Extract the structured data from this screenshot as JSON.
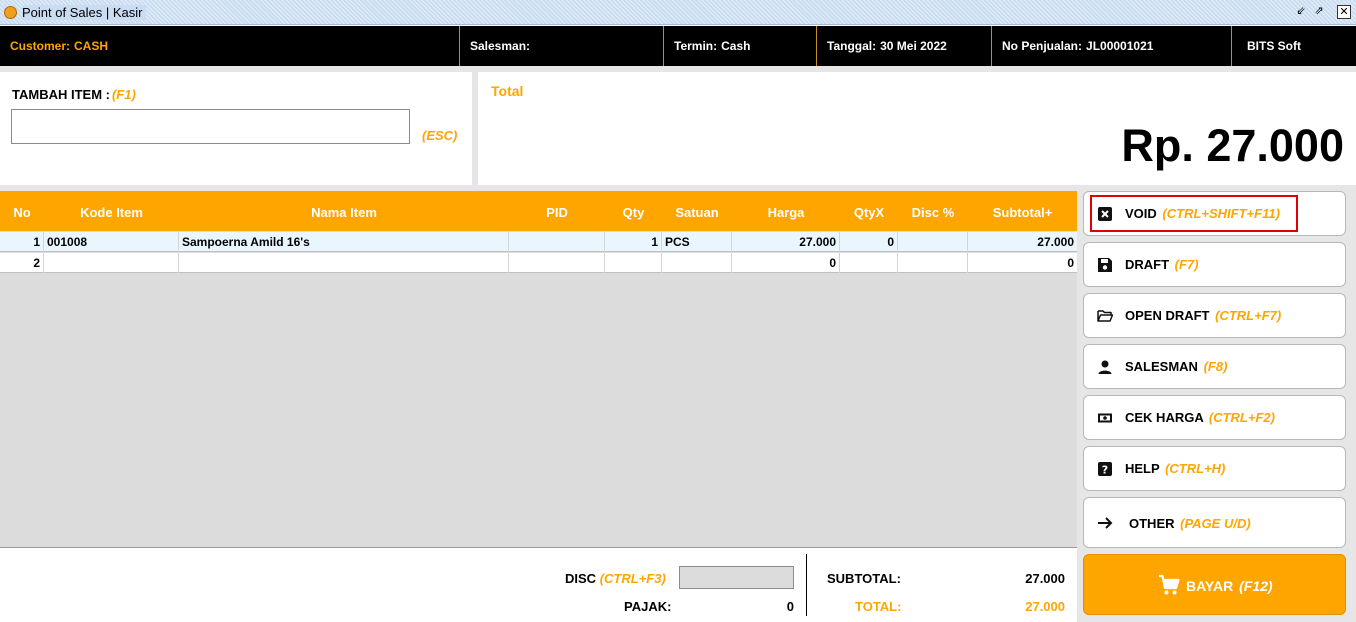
{
  "window": {
    "title": "Point of Sales | Kasir",
    "restore_glyph": "⇙",
    "detach_glyph": "⇗",
    "close_glyph": "✕"
  },
  "infobar": {
    "customer_label": "Customer:",
    "customer_value": "CASH",
    "salesman_label": "Salesman:",
    "salesman_value": "",
    "termin_label": "Termin:",
    "termin_value": "Cash",
    "tanggal_label": "Tanggal:",
    "tanggal_value": "30 Mei 2022",
    "no_label": "No Penjualan:",
    "no_value": "JL00001021",
    "brand": "BITS Soft"
  },
  "add_item": {
    "label": "TAMBAH ITEM :",
    "hotkey": "(F1)",
    "input_value": "",
    "esc_hint": "(ESC)"
  },
  "total": {
    "label": "Total",
    "amount": "Rp. 27.000"
  },
  "grid": {
    "columns": [
      "No",
      "Kode Item",
      "Nama Item",
      "PID",
      "Qty",
      "Satuan",
      "Harga",
      "QtyX",
      "Disc %",
      "Subtotal+"
    ],
    "rows": [
      {
        "no": "1",
        "kode": "001008",
        "nama": "Sampoerna Amild 16's",
        "pid": "",
        "qty": "1",
        "satuan": "PCS",
        "harga": "27.000",
        "qtyx": "0",
        "disc": "",
        "subtotal": "27.000"
      },
      {
        "no": "2",
        "kode": "",
        "nama": "",
        "pid": "",
        "qty": "",
        "satuan": "",
        "harga": "0",
        "qtyx": "",
        "disc": "",
        "subtotal": "0"
      }
    ]
  },
  "actions": {
    "void": {
      "label": "VOID",
      "hotkey": "(CTRL+SHIFT+F11)",
      "icon": "void-icon"
    },
    "draft": {
      "label": "DRAFT",
      "hotkey": "(F7)",
      "icon": "save-icon"
    },
    "open_draft": {
      "label": "OPEN DRAFT",
      "hotkey": "(CTRL+F7)",
      "icon": "folder-open-icon"
    },
    "salesman": {
      "label": "SALESMAN",
      "hotkey": "(F8)",
      "icon": "person-icon"
    },
    "cek_harga": {
      "label": "CEK HARGA",
      "hotkey": "(CTRL+F2)",
      "icon": "money-icon"
    },
    "help": {
      "label": "HELP",
      "hotkey": "(CTRL+H)",
      "icon": "help-icon"
    },
    "other": {
      "label": "OTHER",
      "hotkey": "(PAGE U/D)",
      "icon": "arrow-right-icon"
    },
    "bayar": {
      "label": "BAYAR",
      "hotkey": "(F12)",
      "icon": "cart-icon"
    }
  },
  "summary": {
    "disc_label": "DISC",
    "disc_hotkey": "(CTRL+F3)",
    "disc_value": "",
    "pajak_label": "PAJAK:",
    "pajak_value": "0",
    "subtotal_label": "SUBTOTAL:",
    "subtotal_value": "27.000",
    "total_label": "TOTAL:",
    "total_value": "27.000"
  },
  "colors": {
    "accent": "#ffa500",
    "infobar_bg": "#000000",
    "highlight": "#e00000"
  }
}
